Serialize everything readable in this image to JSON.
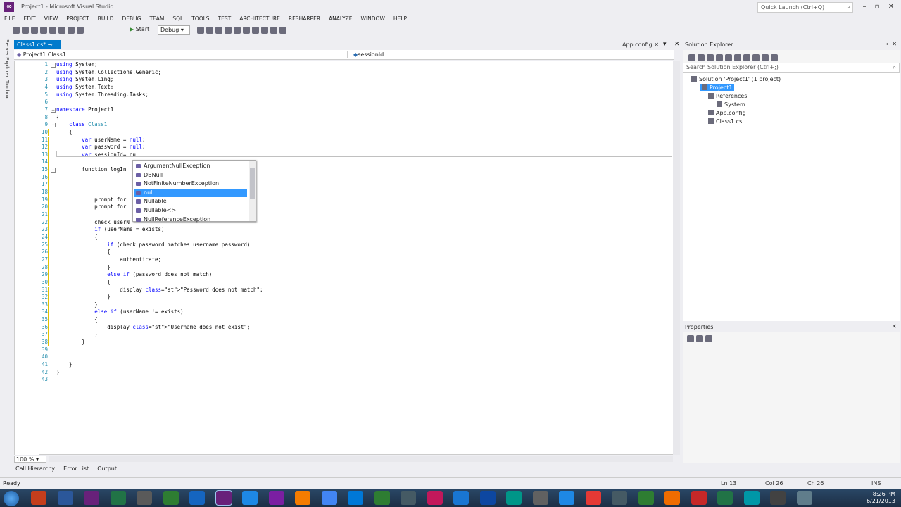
{
  "window": {
    "title": "Project1 - Microsoft Visual Studio",
    "quick_launch_placeholder": "Quick Launch (Ctrl+Q)"
  },
  "menu": [
    "FILE",
    "EDIT",
    "VIEW",
    "PROJECT",
    "BUILD",
    "DEBUG",
    "TEAM",
    "SQL",
    "TOOLS",
    "TEST",
    "ARCHITECTURE",
    "RESHARPER",
    "ANALYZE",
    "WINDOW",
    "HELP"
  ],
  "toolbar": {
    "start_label": "Start",
    "config": "Debug"
  },
  "side_tabs": [
    "Server Explorer",
    "Toolbox"
  ],
  "tabs": {
    "active": "Class1.cs*",
    "other": "App.config"
  },
  "navbar": {
    "left": "Project1.Class1",
    "right": "sessionId"
  },
  "code_lines": [
    "using System;",
    "using System.Collections.Generic;",
    "using System.Linq;",
    "using System.Text;",
    "using System.Threading.Tasks;",
    "",
    "namespace Project1",
    "{",
    "    class Class1",
    "    {",
    "        var userName = null;",
    "        var password = null;",
    "        var sessionId= nu",
    "",
    "        function logIn",
    "",
    "",
    "",
    "            prompt for",
    "            prompt for",
    "",
    "            check userN",
    "            if (userName = exists)",
    "            {",
    "                if (check password matches username.password)",
    "                {",
    "                    authenticate;",
    "                }",
    "                else if (password does not match)",
    "                {",
    "                    display \"Password does not match\";",
    "                }",
    "            }",
    "            else if (userName != exists)",
    "            {",
    "                display \"Username does not exist\";",
    "            }",
    "        }",
    "",
    "",
    "    }",
    "}",
    ""
  ],
  "completion": [
    "ArgumentNullException",
    "DBNull",
    "NotFiniteNumberException",
    "null",
    "Nullable",
    "Nullable<>",
    "NullReferenceException"
  ],
  "completion_selected": 3,
  "zoom": "100 %",
  "bottom_tabs": [
    "Call Hierarchy",
    "Error List",
    "Output"
  ],
  "solution_explorer": {
    "title": "Solution Explorer",
    "search_placeholder": "Search Solution Explorer (Ctrl+;)",
    "tree": [
      {
        "label": "Solution 'Project1' (1 project)",
        "depth": 0
      },
      {
        "label": "Project1",
        "depth": 1,
        "selected": true
      },
      {
        "label": "References",
        "depth": 2
      },
      {
        "label": "System",
        "depth": 3
      },
      {
        "label": "App.config",
        "depth": 2
      },
      {
        "label": "Class1.cs",
        "depth": 2
      }
    ]
  },
  "properties": {
    "title": "Properties"
  },
  "status": {
    "text": "Ready",
    "ln": "Ln 13",
    "col": "Col 26",
    "ch": "Ch 26",
    "mode": "INS"
  },
  "clock": {
    "time": "8:26 PM",
    "date": "6/21/2013"
  },
  "colors": {
    "accent": "#007acc",
    "selection": "#3399ff",
    "keyword": "#0000ff",
    "type": "#2b91af",
    "string": "#a31515"
  }
}
